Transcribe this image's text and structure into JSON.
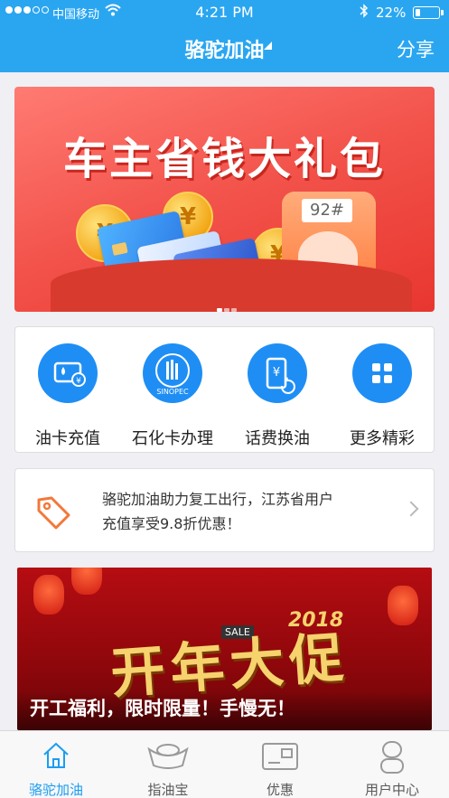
{
  "status_bar": {
    "carrier": "中国移动",
    "time": "4:21 PM",
    "battery_pct": "22%",
    "battery_level": 0.22,
    "signal_bars_filled": 3,
    "signal_bars_total": 5
  },
  "header": {
    "title": "骆驼加油",
    "share_label": "分享",
    "bg_color": "#2aa6f1"
  },
  "banner": {
    "title": "车主省钱大礼包",
    "meter_value": "92#",
    "page_count": 3,
    "active_page": 1
  },
  "menu": {
    "items": [
      {
        "label": "油卡充值",
        "icon": "fuel-card-recharge-icon"
      },
      {
        "label": "石化卡办理",
        "icon": "sinopec-logo-icon"
      },
      {
        "label": "话费换油",
        "icon": "phone-bill-exchange-icon"
      },
      {
        "label": "更多精彩",
        "icon": "grid-more-icon"
      }
    ],
    "icon_color": "#1f8ef4"
  },
  "notice": {
    "line1": "骆驼加油助力复工出行，江苏省用户",
    "line2": "充值享受9.8折优惠！",
    "icon": "price-tag-icon",
    "icon_color": "#f2783a"
  },
  "promo": {
    "headline": "开年大促",
    "sale": "SALE",
    "year": "2018",
    "caption": "开工福利，限时限量！手慢无！"
  },
  "tabbar": {
    "tabs": [
      {
        "label": "骆驼加油",
        "icon": "home-icon",
        "active": true
      },
      {
        "label": "指油宝",
        "icon": "gold-ingot-icon",
        "active": false
      },
      {
        "label": "优惠",
        "icon": "coupon-card-icon",
        "active": false
      },
      {
        "label": "用户中心",
        "icon": "user-icon",
        "active": false
      }
    ],
    "active_color": "#1c9df0"
  }
}
